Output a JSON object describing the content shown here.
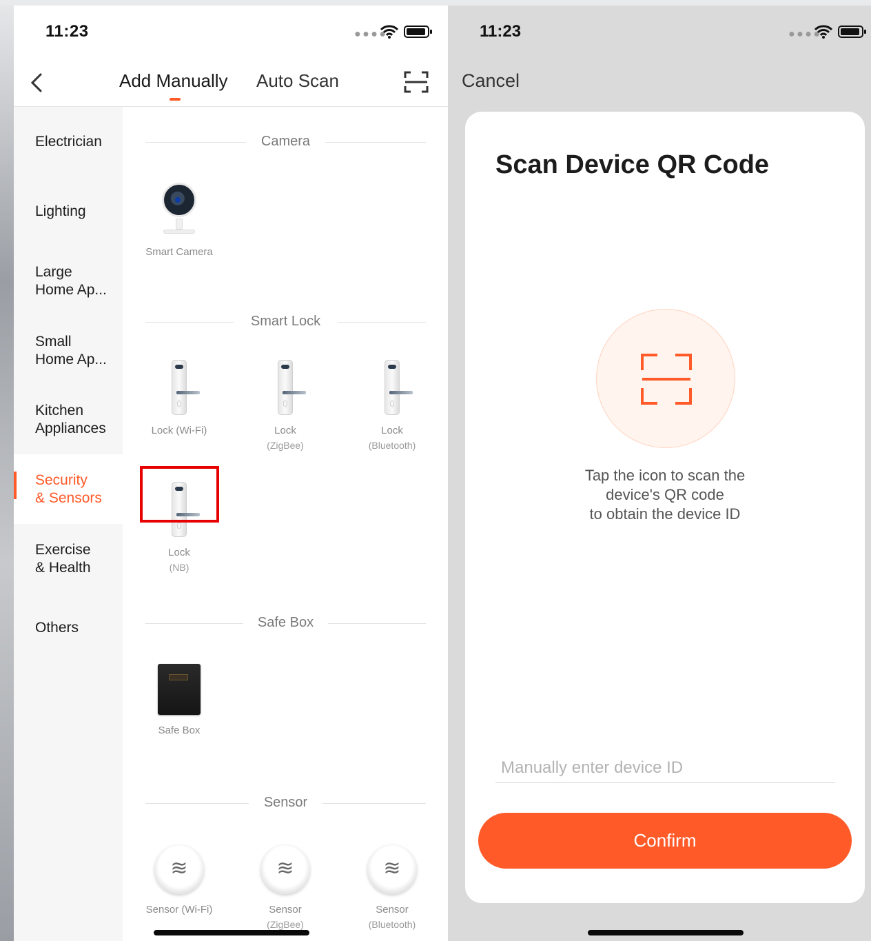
{
  "left": {
    "status_time": "11:23",
    "tabs": {
      "active": "Add Manually",
      "inactive": "Auto Scan"
    },
    "sidebar": [
      {
        "line1": "Electrician",
        "line2": ""
      },
      {
        "line1": "Lighting",
        "line2": ""
      },
      {
        "line1": "Large",
        "line2": "Home Ap..."
      },
      {
        "line1": "Small",
        "line2": "Home Ap..."
      },
      {
        "line1": "Kitchen",
        "line2": "Appliances"
      },
      {
        "line1": "Security",
        "line2": "& Sensors"
      },
      {
        "line1": "Exercise",
        "line2": "& Health"
      },
      {
        "line1": "Others",
        "line2": ""
      }
    ],
    "sections": {
      "camera": "Camera",
      "smart_lock": "Smart Lock",
      "safe_box": "Safe Box",
      "sensor": "Sensor"
    },
    "devices": {
      "smart_camera": {
        "name": "Smart Camera"
      },
      "lock_wifi": {
        "name": "Lock (Wi-Fi)"
      },
      "lock_zigbee": {
        "name": "Lock",
        "sub": "(ZigBee)"
      },
      "lock_bluetooth": {
        "name": "Lock",
        "sub": "(Bluetooth)"
      },
      "lock_nb": {
        "name": "Lock",
        "sub": "(NB)"
      },
      "safe_box": {
        "name": "Safe Box"
      },
      "sensor_wifi": {
        "name": "Sensor (Wi-Fi)"
      },
      "sensor_zigbee": {
        "name": "Sensor",
        "sub": "(ZigBee)"
      },
      "sensor_bluetooth": {
        "name": "Sensor",
        "sub": "(Bluetooth)"
      }
    }
  },
  "right": {
    "status_time": "11:23",
    "cancel_label": "Cancel",
    "title": "Scan Device QR Code",
    "instructions": [
      "Tap the icon to scan the",
      "device's QR code",
      "to obtain the device ID"
    ],
    "device_id_placeholder": "Manually enter device ID",
    "confirm_label": "Confirm"
  },
  "colors": {
    "accent": "#ff5a28",
    "highlight": "#e60000"
  }
}
